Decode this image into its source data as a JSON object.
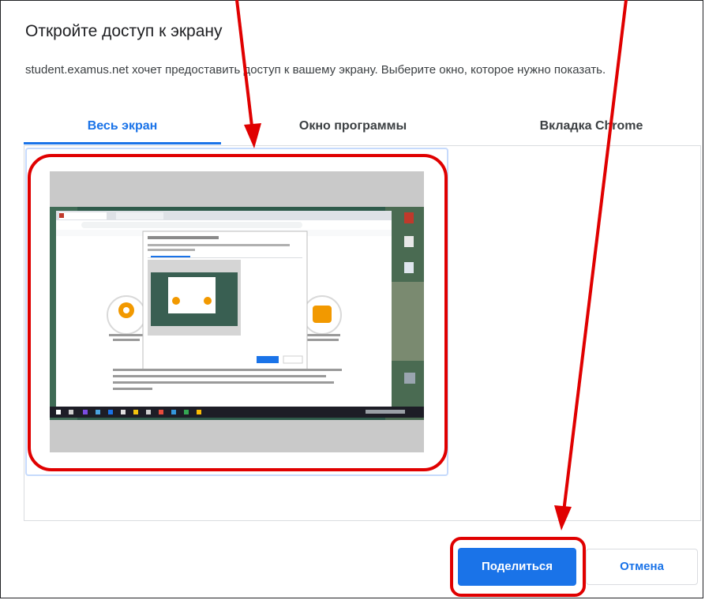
{
  "dialog": {
    "title": "Откройте доступ к экрану",
    "description": "student.examus.net хочет предоставить доступ к вашему экрану. Выберите окно, которое нужно показать."
  },
  "tabs": [
    {
      "label": "Весь экран",
      "active": true
    },
    {
      "label": "Окно программы",
      "active": false
    },
    {
      "label": "Вкладка Chrome",
      "active": false
    }
  ],
  "buttons": {
    "share": "Поделиться",
    "cancel": "Отмена"
  },
  "colors": {
    "accent": "#1a73e8",
    "annotation": "#e00000",
    "tile_border": "#c6dafc"
  }
}
